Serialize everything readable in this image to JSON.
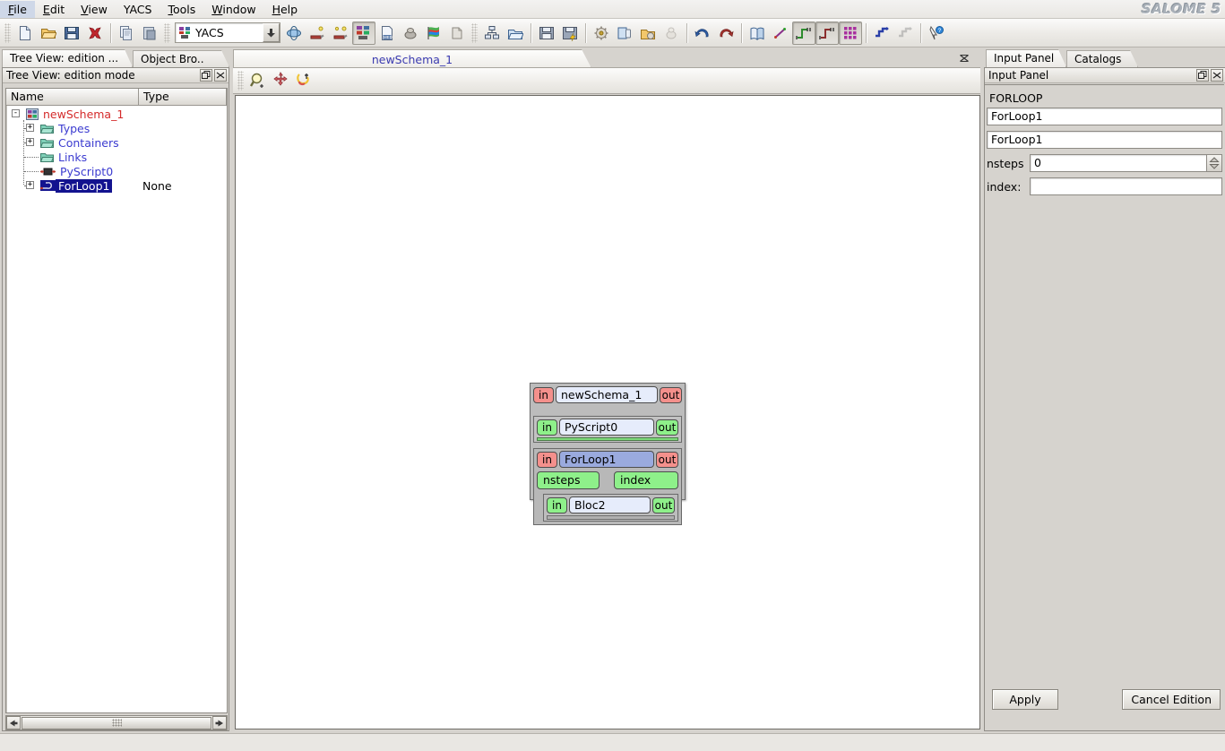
{
  "app": {
    "logo": "SALOME 5"
  },
  "menubar": {
    "items": [
      {
        "label": "File",
        "mnemonic": "F"
      },
      {
        "label": "Edit",
        "mnemonic": "E"
      },
      {
        "label": "View",
        "mnemonic": "V"
      },
      {
        "label": "YACS",
        "mnemonic": ""
      },
      {
        "label": "Tools",
        "mnemonic": "T"
      },
      {
        "label": "Window",
        "mnemonic": "W"
      },
      {
        "label": "Help",
        "mnemonic": "H"
      }
    ]
  },
  "toolbar": {
    "module_combo": {
      "value": "YACS",
      "icon": "yacs-module-icon"
    },
    "buttons": [
      {
        "name": "new-document-icon",
        "tip": "New"
      },
      {
        "name": "open-document-icon",
        "tip": "Open"
      },
      {
        "name": "save-document-icon",
        "tip": "Save"
      },
      {
        "name": "delete-icon",
        "tip": "Delete"
      },
      {
        "name": "copy-icon",
        "tip": "Copy"
      },
      {
        "name": "paste-icon",
        "tip": "Paste"
      },
      {
        "name": "geometry-module-icon",
        "tip": "Geometry"
      },
      {
        "name": "mesh-module-icon",
        "tip": "Mesh"
      },
      {
        "name": "mesh2-module-icon",
        "tip": "Mesh 2"
      },
      {
        "name": "yacs-schema-icon",
        "tip": "YACS",
        "pressed": true
      },
      {
        "name": "med-module-icon",
        "tip": "MED"
      },
      {
        "name": "post-pro-icon",
        "tip": "Post-Pro"
      },
      {
        "name": "visu-module-icon",
        "tip": "VISU"
      },
      {
        "name": "component-icon",
        "tip": "Component"
      },
      {
        "name": "new-schema-icon",
        "tip": "New schema"
      },
      {
        "name": "import-schema-icon",
        "tip": "Import schema"
      },
      {
        "name": "export-schema-icon",
        "tip": "Export schema"
      },
      {
        "name": "export-schema-as-icon",
        "tip": "Export schema as"
      },
      {
        "name": "run-settings-icon",
        "tip": "Run settings"
      },
      {
        "name": "import-catalog-icon",
        "tip": "Import catalog"
      },
      {
        "name": "load-batch-icon",
        "tip": "Load batch"
      },
      {
        "name": "run-icon",
        "tip": "Run"
      },
      {
        "name": "undo-icon",
        "tip": "Undo"
      },
      {
        "name": "redo-icon",
        "tip": "Redo"
      },
      {
        "name": "whats-this-book-icon",
        "tip": "Documentation"
      },
      {
        "name": "link-node-icon",
        "tip": "Create link"
      },
      {
        "name": "control-link-icon",
        "tip": "Control link",
        "pressed": true
      },
      {
        "name": "data-link-icon",
        "tip": "Data link",
        "pressed": true
      },
      {
        "name": "grid-arrange-icon",
        "tip": "Arrange nodes",
        "pressed": true
      },
      {
        "name": "zigzag-link-icon",
        "tip": "Zigzag link"
      },
      {
        "name": "zigzag-link2-icon",
        "tip": "Zigzag link 2"
      },
      {
        "name": "whats-this-icon",
        "tip": "What's This?"
      }
    ]
  },
  "left_panel": {
    "tabs": [
      {
        "label": "Tree View: edition ...",
        "active": true,
        "name": "tab-tree-view"
      },
      {
        "label": "Object Bro..",
        "active": false,
        "name": "tab-object-browser"
      }
    ],
    "dock_title": "Tree View: edition mode",
    "columns": [
      "Name",
      "Type"
    ],
    "tree": [
      {
        "label": "newSchema_1",
        "type": "",
        "depth": 0,
        "expander": "-",
        "icon": "schema-icon",
        "style": "root",
        "selected": false
      },
      {
        "label": "Types",
        "type": "",
        "depth": 1,
        "expander": "+",
        "icon": "folder-icon",
        "style": "normal",
        "selected": false
      },
      {
        "label": "Containers",
        "type": "",
        "depth": 1,
        "expander": "+",
        "icon": "folder-icon",
        "style": "normal",
        "selected": false
      },
      {
        "label": "Links",
        "type": "",
        "depth": 1,
        "expander": "",
        "icon": "folder-icon",
        "style": "normal",
        "selected": false
      },
      {
        "label": "PyScript0",
        "type": "",
        "depth": 1,
        "expander": "",
        "icon": "pyscript-icon",
        "style": "normal",
        "selected": false
      },
      {
        "label": "ForLoop1",
        "type": "None",
        "depth": 1,
        "expander": "+",
        "icon": "forloop-icon",
        "style": "selected",
        "selected": true
      }
    ]
  },
  "center": {
    "tab_title": "newSchema_1",
    "view_tools": [
      {
        "name": "zoom-icon",
        "tip": "Zoom"
      },
      {
        "name": "pan-icon",
        "tip": "Pan"
      },
      {
        "name": "fit-all-icon",
        "tip": "Fit all"
      }
    ],
    "schema": {
      "root": {
        "name": "newSchema_1",
        "in_port": "in",
        "out_port": "out",
        "port_color": "#f4908c",
        "selected": false
      },
      "children": [
        {
          "kind": "pyscript",
          "name": "PyScript0",
          "in_port": "in",
          "out_port": "out",
          "port_color": "#8ef08a",
          "selected": false
        },
        {
          "kind": "forloop",
          "name": "ForLoop1",
          "in_port": "in",
          "out_port": "out",
          "port_color": "#f4908c",
          "selected": true,
          "data_ports": [
            {
              "label": "nsteps",
              "side": "left"
            },
            {
              "label": "index",
              "side": "right"
            }
          ],
          "body": {
            "kind": "bloc",
            "name": "Bloc2",
            "in_port": "in",
            "out_port": "out",
            "port_color": "#8ef08a",
            "selected": false
          }
        }
      ]
    }
  },
  "right_panel": {
    "tabs": [
      {
        "label": "Input Panel",
        "active": true,
        "name": "tab-input-panel"
      },
      {
        "label": "Catalogs",
        "active": false,
        "name": "tab-catalogs"
      }
    ],
    "dock_title": "Input Panel",
    "node_kind": "FORLOOP",
    "fields": {
      "name_value": "ForLoop1",
      "type_value": "ForLoop1",
      "nsteps_label": "nsteps",
      "nsteps_value": "0",
      "index_label": "index:",
      "index_value": ""
    },
    "buttons": {
      "apply": "Apply",
      "cancel": "Cancel Edition"
    }
  },
  "statusbar": {
    "text": ""
  }
}
